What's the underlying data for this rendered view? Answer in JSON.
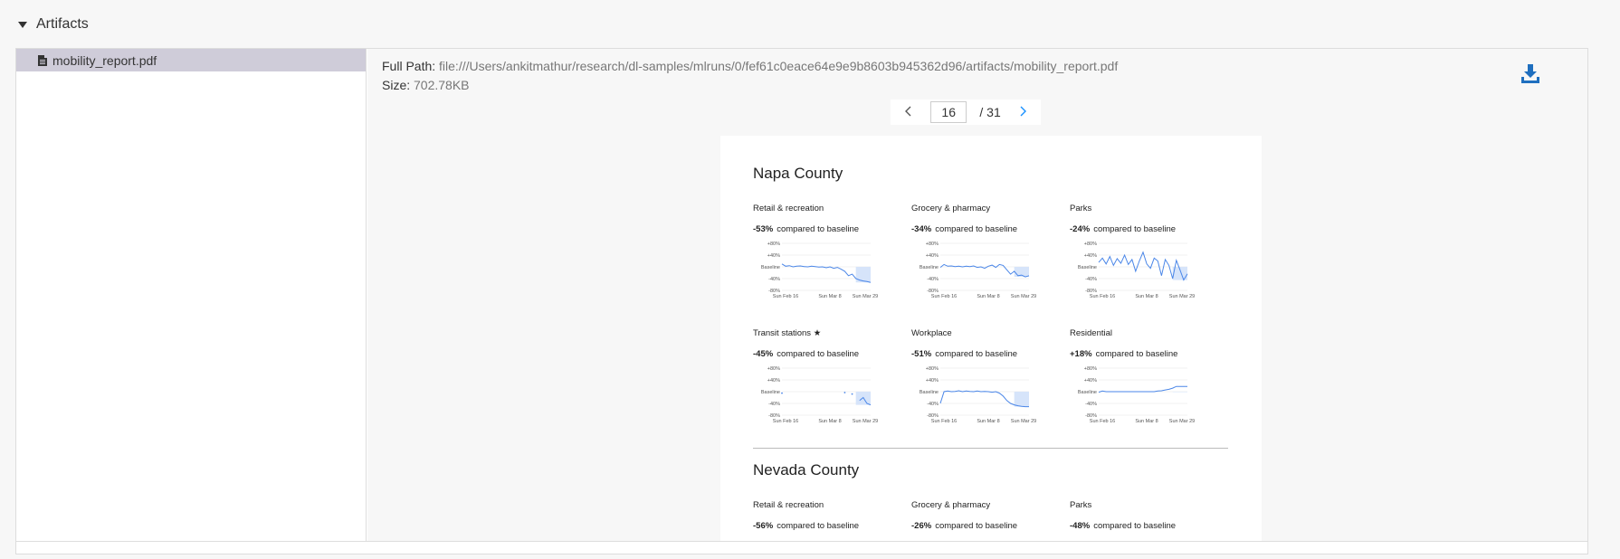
{
  "section": {
    "title": "Artifacts"
  },
  "file_tree": {
    "items": [
      {
        "label": "mobility_report.pdf",
        "selected": true
      }
    ]
  },
  "viewer": {
    "full_path_label": "Full Path:",
    "full_path_value": "file:///Users/ankitmathur/research/dl-samples/mlruns/0/fef61c0eace64e9e9b8603b945362d96/artifacts/mobility_report.pdf",
    "size_label": "Size:",
    "size_value": "702.78KB",
    "download_icon": "download-icon"
  },
  "pager": {
    "current_page": "16",
    "total": "/  31",
    "prev_icon": "chevron-left-icon",
    "next_icon": "chevron-right-icon"
  },
  "colors": {
    "accent": "#1890ff",
    "chart_line": "#4a86e8",
    "chart_fill": "#d6e4fa",
    "selected_row": "#cfccd9"
  },
  "pdf": {
    "counties": [
      {
        "name": "Napa County",
        "metrics": [
          {
            "name": "Retail & recreation",
            "value": "-53%",
            "suffix": "compared to baseline"
          },
          {
            "name": "Grocery & pharmacy",
            "value": "-34%",
            "suffix": "compared to baseline"
          },
          {
            "name": "Parks",
            "value": "-24%",
            "suffix": "compared to baseline"
          },
          {
            "name": "Transit stations ★",
            "value": "-45%",
            "suffix": "compared to baseline"
          },
          {
            "name": "Workplace",
            "value": "-51%",
            "suffix": "compared to baseline"
          },
          {
            "name": "Residential",
            "value": "+18%",
            "suffix": "compared to baseline"
          }
        ]
      },
      {
        "name": "Nevada County",
        "metrics": [
          {
            "name": "Retail & recreation",
            "value": "-56%",
            "suffix": "compared to baseline"
          },
          {
            "name": "Grocery & pharmacy",
            "value": "-26%",
            "suffix": "compared to baseline"
          },
          {
            "name": "Parks",
            "value": "-48%",
            "suffix": "compared to baseline"
          }
        ]
      }
    ],
    "chart_axis": {
      "y_ticks": [
        "+80%",
        "+40%",
        "Baseline",
        "-40%",
        "-80%"
      ],
      "x_ticks": [
        "Sun Feb 16",
        "Sun Mar 8",
        "Sun Mar 29"
      ]
    }
  },
  "chart_data": [
    {
      "type": "line",
      "title": "Retail & recreation",
      "x": [
        "Sun Feb 16",
        "Sun Mar 8",
        "Sun Mar 29"
      ],
      "ylim": [
        -80,
        80
      ],
      "values": [
        10,
        2,
        4,
        0,
        2,
        3,
        1,
        0,
        2,
        1,
        -1,
        0,
        -3,
        0,
        -5,
        -2,
        -8,
        -15,
        -30,
        -25,
        -40,
        -45,
        -48,
        -50,
        -53
      ]
    },
    {
      "type": "line",
      "title": "Grocery & pharmacy",
      "x": [
        "Sun Feb 16",
        "Sun Mar 8",
        "Sun Mar 29"
      ],
      "ylim": [
        -80,
        80
      ],
      "values": [
        -2,
        8,
        2,
        3,
        1,
        2,
        0,
        2,
        1,
        3,
        -2,
        0,
        -5,
        2,
        6,
        -2,
        8,
        5,
        -10,
        -25,
        -15,
        -30,
        -28,
        -34,
        -30
      ]
    },
    {
      "type": "line",
      "title": "Parks",
      "x": [
        "Sun Feb 16",
        "Sun Mar 8",
        "Sun Mar 29"
      ],
      "ylim": [
        -80,
        80
      ],
      "values": [
        15,
        30,
        10,
        35,
        5,
        28,
        12,
        40,
        8,
        25,
        -15,
        20,
        50,
        10,
        -5,
        30,
        20,
        -30,
        25,
        5,
        -40,
        22,
        -10,
        -45,
        -24
      ]
    },
    {
      "type": "line",
      "title": "Transit stations",
      "x": [
        "Sun Feb 16",
        "Sun Mar 8",
        "Sun Mar 29"
      ],
      "ylim": [
        -80,
        80
      ],
      "values": [
        -5,
        null,
        null,
        null,
        null,
        null,
        null,
        null,
        null,
        null,
        null,
        null,
        null,
        null,
        null,
        null,
        null,
        -3,
        null,
        -8,
        null,
        -30,
        -20,
        -40,
        -45
      ]
    },
    {
      "type": "line",
      "title": "Workplace",
      "x": [
        "Sun Feb 16",
        "Sun Mar 8",
        "Sun Mar 29"
      ],
      "ylim": [
        -80,
        80
      ],
      "values": [
        -40,
        0,
        2,
        0,
        1,
        3,
        0,
        2,
        1,
        0,
        2,
        0,
        1,
        0,
        -2,
        0,
        -5,
        -15,
        -30,
        -40,
        -45,
        -48,
        -50,
        -51,
        -51
      ]
    },
    {
      "type": "line",
      "title": "Residential",
      "x": [
        "Sun Feb 16",
        "Sun Mar 8",
        "Sun Mar 29"
      ],
      "ylim": [
        -80,
        80
      ],
      "values": [
        -2,
        2,
        0,
        0,
        0,
        0,
        0,
        0,
        0,
        0,
        0,
        0,
        0,
        0,
        0,
        0,
        2,
        3,
        6,
        8,
        12,
        18,
        18,
        18,
        18
      ]
    }
  ]
}
